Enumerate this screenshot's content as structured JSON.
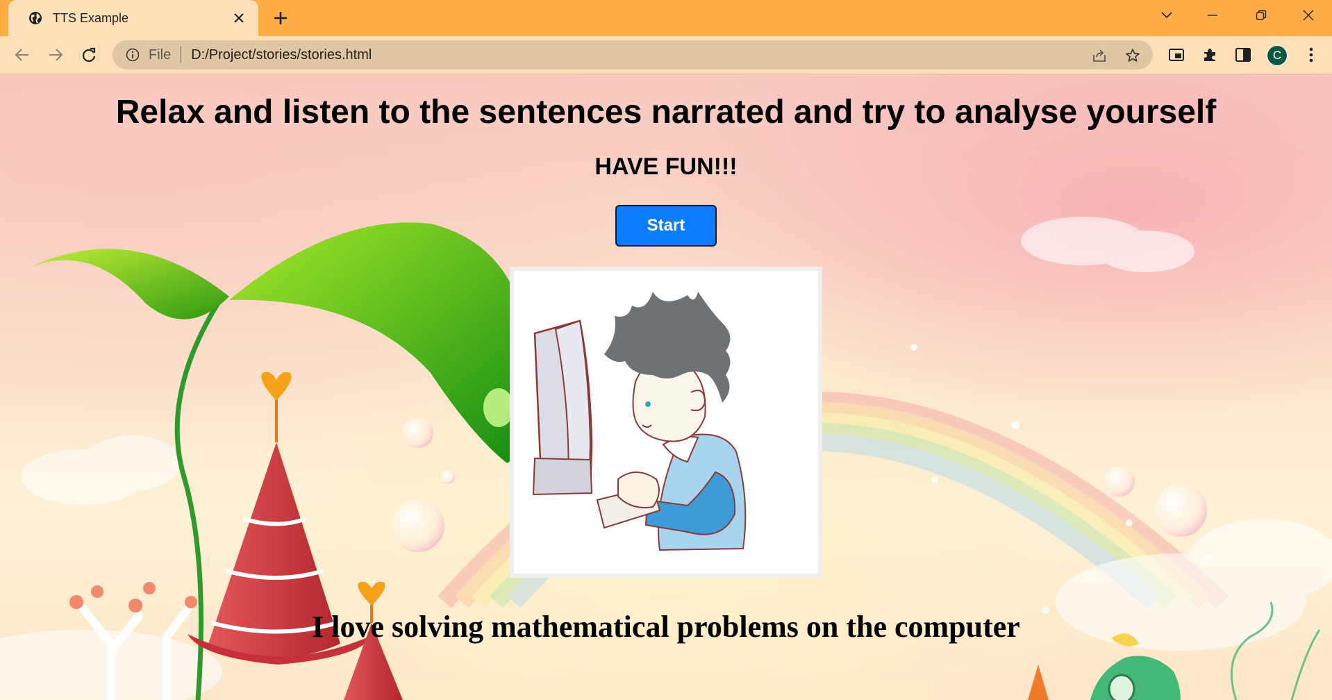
{
  "browser": {
    "tab_title": "TTS Example",
    "address_scheme": "File",
    "address_url": "D:/Project/stories/stories.html",
    "profile_initial": "C"
  },
  "page": {
    "headline": "Relax and listen to the sentences narrated and try to analyse yourself",
    "subheading": "HAVE FUN!!!",
    "start_label": "Start",
    "sentence": "I love solving mathematical problems on the computer"
  },
  "colors": {
    "tab_strip": "#ffad45",
    "toolbar": "#ffe0b8",
    "start_button": "#0b7dfa",
    "avatar": "#0b5940"
  }
}
